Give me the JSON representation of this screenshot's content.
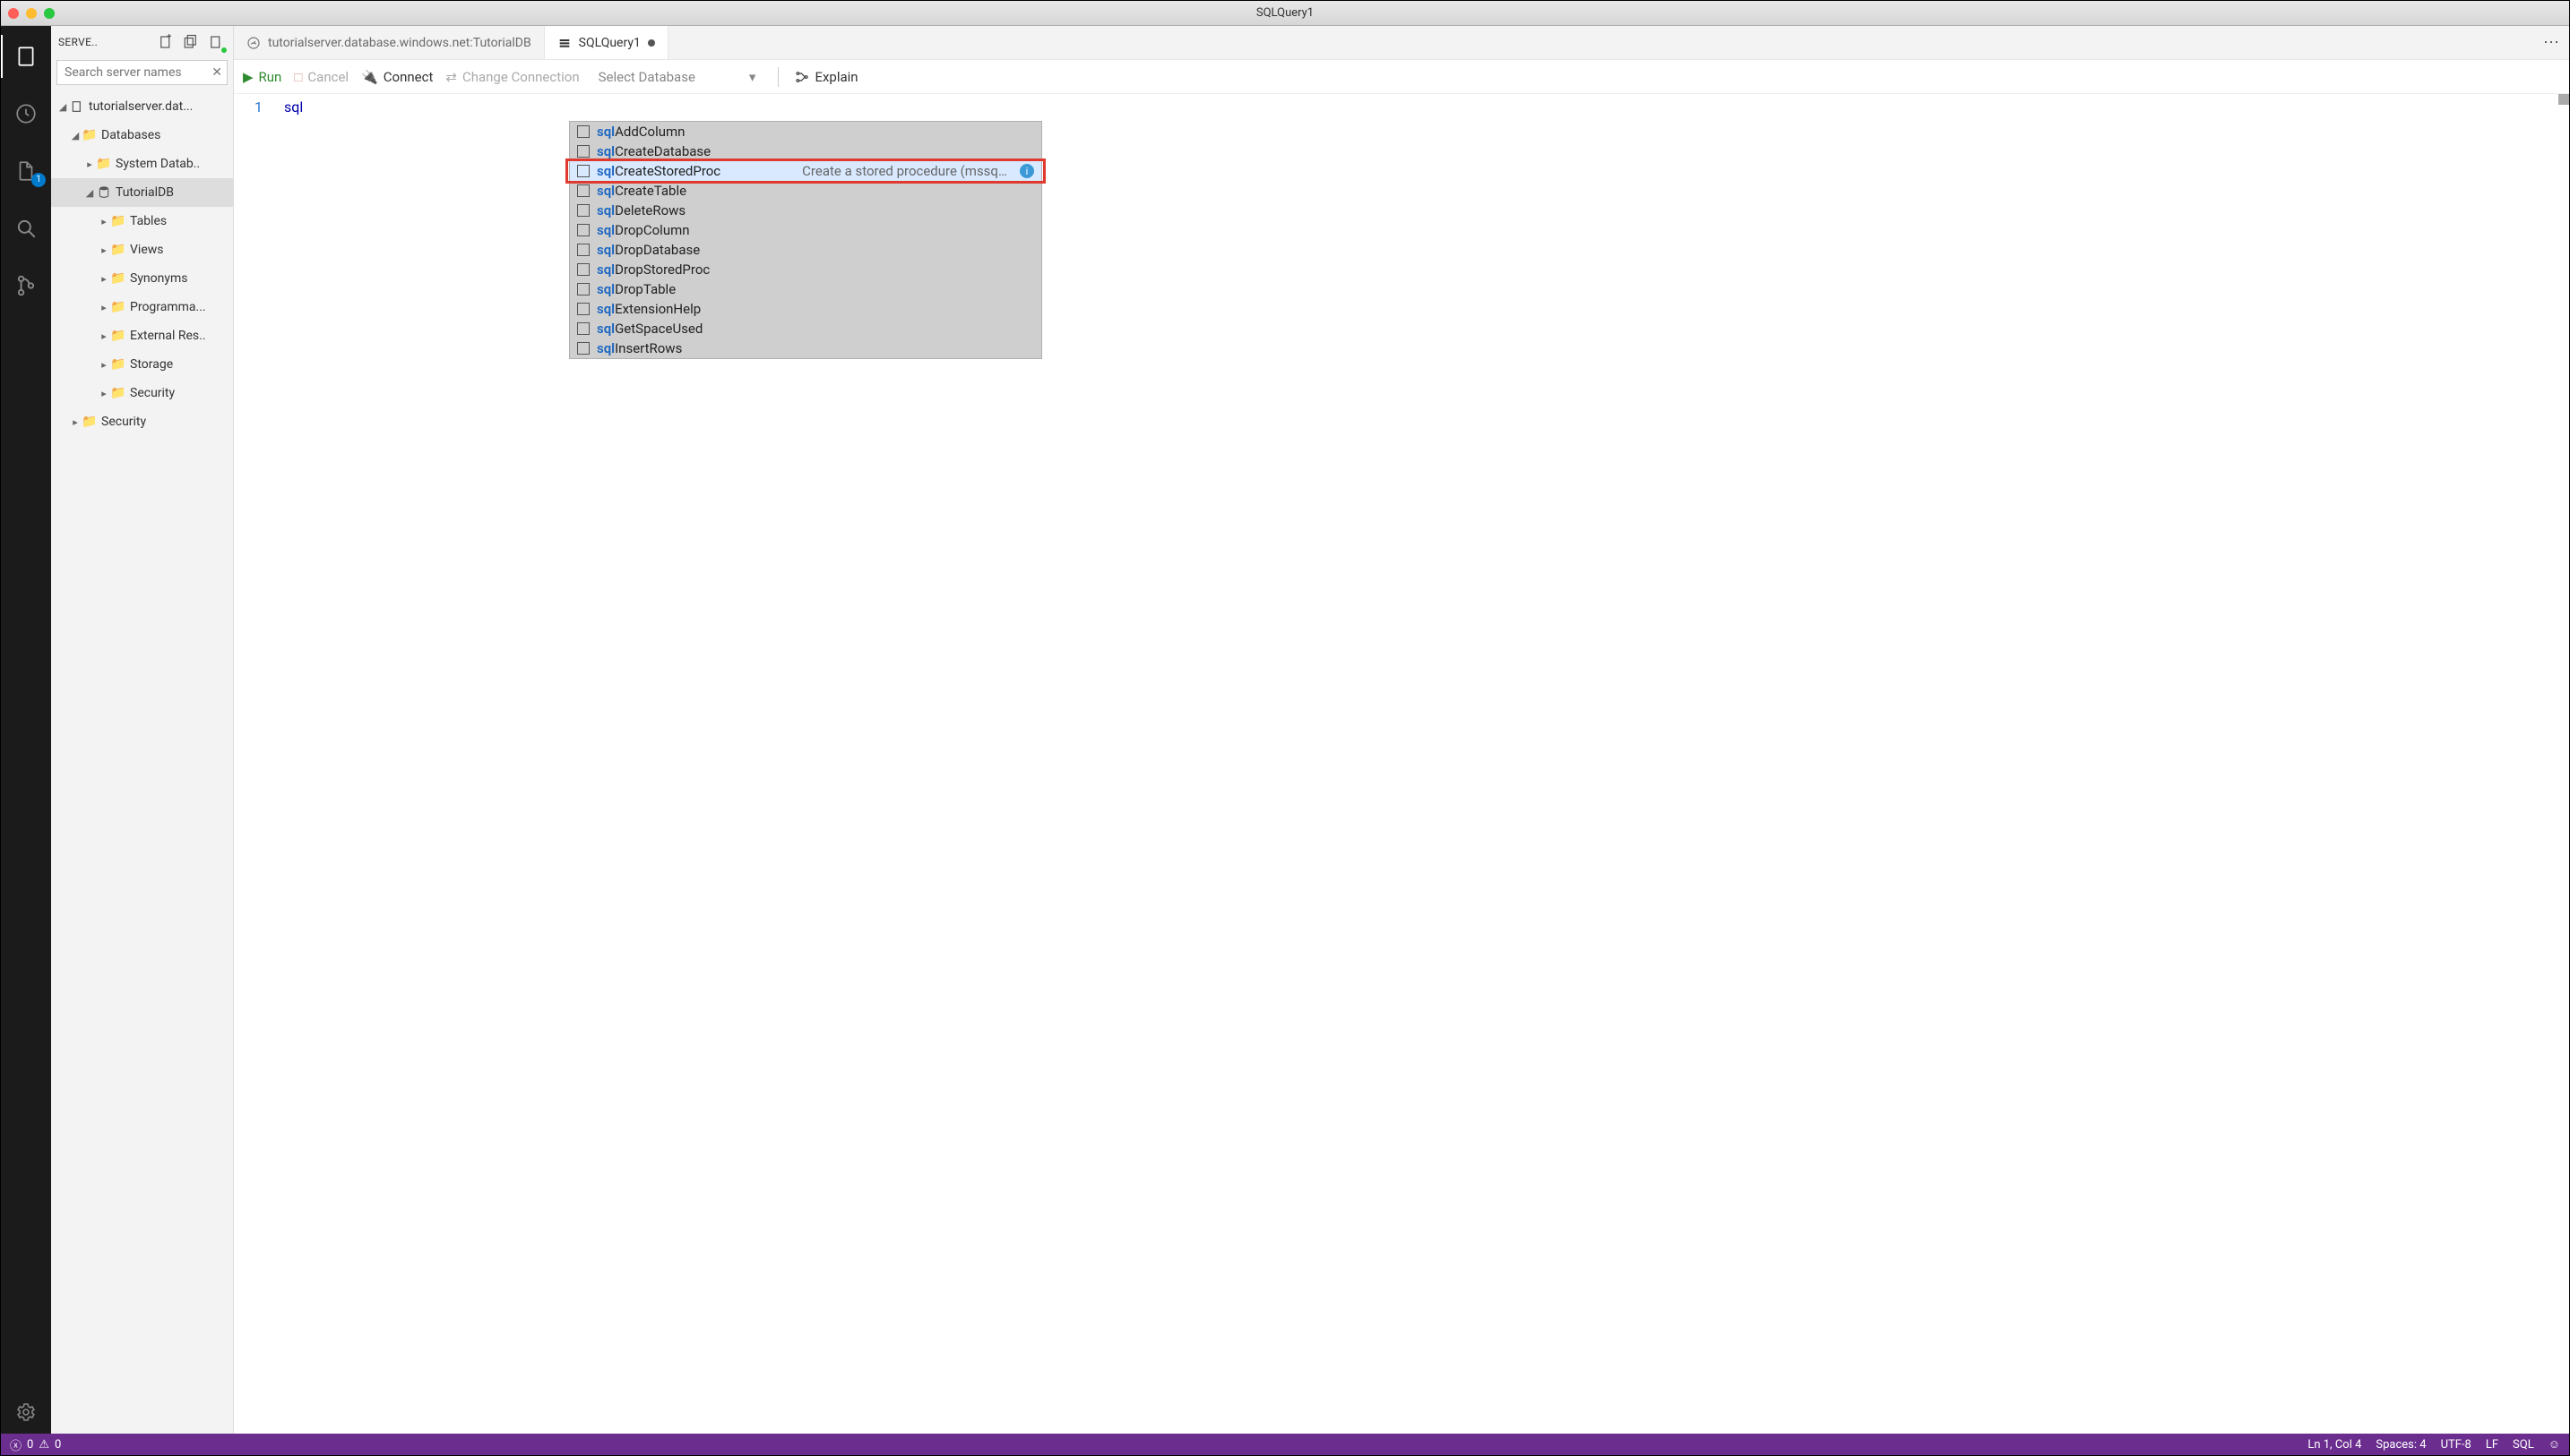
{
  "window": {
    "title": "SQLQuery1"
  },
  "activity": {
    "fileBadge": "1"
  },
  "sidebar": {
    "headerLabel": "SERVE..",
    "searchPlaceholder": "Search server names",
    "tree": {
      "server": "tutorialserver.dat...",
      "databases": "Databases",
      "systemDb": "System Datab..",
      "tutorialDb": "TutorialDB",
      "tables": "Tables",
      "views": "Views",
      "synonyms": "Synonyms",
      "programmability": "Programma...",
      "externalRes": "External Res..",
      "storage": "Storage",
      "securityInner": "Security",
      "securityOuter": "Security"
    }
  },
  "tabs": {
    "dashboard": "tutorialserver.database.windows.net:TutorialDB",
    "query": "SQLQuery1"
  },
  "toolbar": {
    "run": "Run",
    "cancel": "Cancel",
    "connect": "Connect",
    "changeConnection": "Change Connection",
    "selectDatabase": "Select Database",
    "explain": "Explain"
  },
  "editor": {
    "lineNumber": "1",
    "typed": "sql",
    "suggestions": [
      {
        "prefix": "sql",
        "rest": "AddColumn",
        "desc": ""
      },
      {
        "prefix": "sql",
        "rest": "CreateDatabase",
        "desc": ""
      },
      {
        "prefix": "sql",
        "rest": "CreateStoredProc",
        "desc": "Create a stored procedure (mssq…",
        "selected": true
      },
      {
        "prefix": "sql",
        "rest": "CreateTable",
        "desc": ""
      },
      {
        "prefix": "sql",
        "rest": "DeleteRows",
        "desc": ""
      },
      {
        "prefix": "sql",
        "rest": "DropColumn",
        "desc": ""
      },
      {
        "prefix": "sql",
        "rest": "DropDatabase",
        "desc": ""
      },
      {
        "prefix": "sql",
        "rest": "DropStoredProc",
        "desc": ""
      },
      {
        "prefix": "sql",
        "rest": "DropTable",
        "desc": ""
      },
      {
        "prefix": "sql",
        "rest": "ExtensionHelp",
        "desc": ""
      },
      {
        "prefix": "sql",
        "rest": "GetSpaceUsed",
        "desc": ""
      },
      {
        "prefix": "sql",
        "rest": "InsertRows",
        "desc": ""
      }
    ]
  },
  "status": {
    "errors": "0",
    "warnings": "0",
    "lnCol": "Ln 1, Col 4",
    "spaces": "Spaces: 4",
    "encoding": "UTF-8",
    "eol": "LF",
    "lang": "SQL"
  }
}
